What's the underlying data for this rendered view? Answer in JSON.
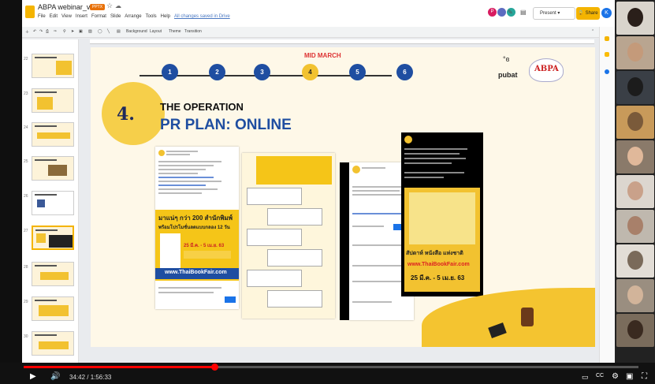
{
  "app": {
    "doc_title": "ABPA webinar_ver2",
    "doc_badge": "PPTX",
    "menu": [
      "File",
      "Edit",
      "View",
      "Insert",
      "Format",
      "Slide",
      "Arrange",
      "Tools",
      "Help"
    ],
    "saved_status": "All changes saved in Drive",
    "avatars": [
      {
        "letter": "P",
        "color": "#d81b60"
      },
      {
        "letter": "",
        "color": "#5c6bc0"
      },
      {
        "letter": "",
        "color": "#26a69a"
      }
    ],
    "present_label": "Present",
    "share_label": "Share",
    "user_initial": "K"
  },
  "toolbar": {
    "items": [
      "Background",
      "Layout",
      "Theme",
      "Transition"
    ]
  },
  "filmstrip": {
    "slide_numbers": [
      "22",
      "23",
      "24",
      "25",
      "26",
      "27",
      "28",
      "29",
      "30"
    ]
  },
  "slide": {
    "timeline_label": "MID MARCH",
    "steps": [
      "1",
      "2",
      "3",
      "4",
      "5",
      "6"
    ],
    "highlight_step": "4",
    "section_number": "4.",
    "heading_1": "THE OPERATION",
    "heading_2": "PR PLAN: ONLINE",
    "logo_pubat": "pubat",
    "logo_abpa": "ABPA",
    "promo_big_text": "มาแน่ๆ กว่า 200 สำนักพิมพ์",
    "promo_sub_text": "พร้อมโปรโมชั่นลดแบบกลอง 12 วัน",
    "promo_dates": "25 มี.ค. - 5 เม.ย. 63",
    "promo_url": "www.ThaiBookFair.com",
    "poster_tag": "สัปดาห์ หนังสือ แห่งชาติ",
    "poster_url": "www.ThaiBookFair.com",
    "poster_dates": "25 มี.ค. - 5 เม.ย. 63"
  },
  "video": {
    "time_current": "34:42",
    "time_total": "1:56:33",
    "time_display": "34:42 / 1:56:33",
    "progress_fraction": 0.31,
    "chapter_text": ""
  },
  "colors": {
    "accent_yellow": "#f2c230",
    "accent_blue": "#1f4ea1",
    "timeline_red": "#dd3333",
    "progress_red": "#ff0000"
  }
}
